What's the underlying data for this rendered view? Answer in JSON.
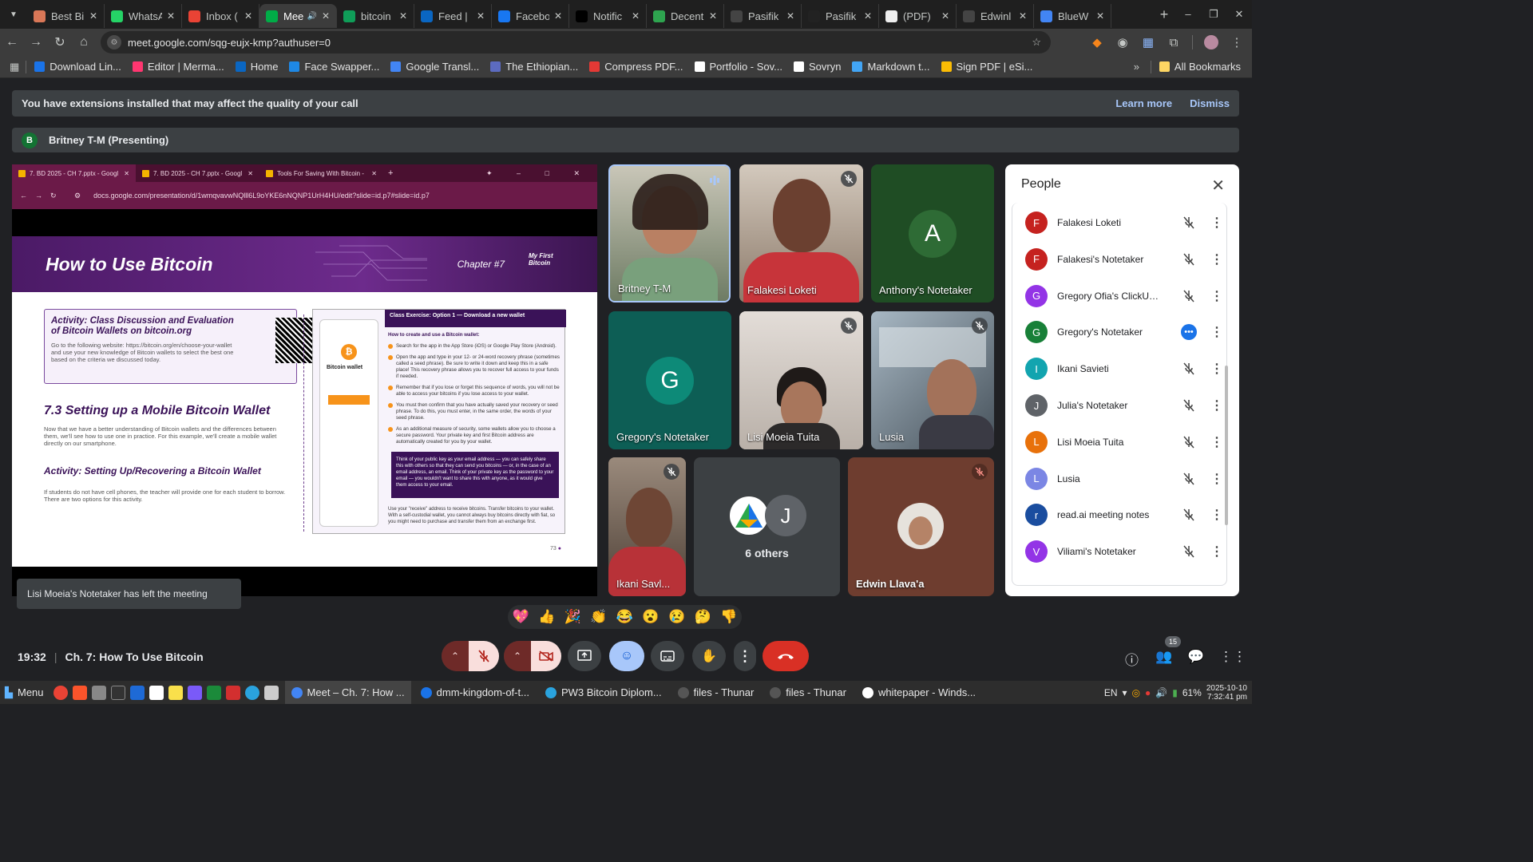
{
  "browser": {
    "tabs": [
      {
        "title": "Best Bi",
        "color": "#d97757",
        "icon": "claude-icon"
      },
      {
        "title": "WhatsA",
        "color": "#25d366",
        "icon": "whatsapp-icon"
      },
      {
        "title": "Inbox (",
        "color": "#ea4335",
        "icon": "gmail-icon"
      },
      {
        "title": "Mee",
        "color": "#00ac47",
        "icon": "meet-icon",
        "active": true
      },
      {
        "title": "bitcoin",
        "color": "#0f9d58",
        "icon": "sheets-icon"
      },
      {
        "title": "Feed |",
        "color": "#0a66c2",
        "icon": "linkedin-icon"
      },
      {
        "title": "Facebo",
        "color": "#1877f2",
        "icon": "facebook-icon"
      },
      {
        "title": "Notific",
        "color": "#000000",
        "icon": "x-icon"
      },
      {
        "title": "Decent",
        "color": "#2ea44f",
        "icon": "upwork-icon"
      },
      {
        "title": "Pasifik",
        "color": "#444444",
        "icon": "github-icon"
      },
      {
        "title": "Pasifik",
        "color": "#222222",
        "icon": "doc-icon"
      },
      {
        "title": "(PDF)",
        "color": "#eeeeee",
        "icon": "researchgate-icon"
      },
      {
        "title": "Edwinl",
        "color": "#444444",
        "icon": "github-icon"
      },
      {
        "title": "BlueW",
        "color": "#4285f4",
        "icon": "site-icon"
      }
    ],
    "url": "meet.google.com/sqg-eujx-kmp?authuser=0",
    "bookmarks": [
      {
        "label": "Download Lin...",
        "color": "#1a73e8"
      },
      {
        "label": "Editor | Merma...",
        "color": "#ff3670"
      },
      {
        "label": "Home",
        "color": "#0a66c2"
      },
      {
        "label": "Face Swapper...",
        "color": "#1e88e5"
      },
      {
        "label": "Google Transl...",
        "color": "#4285f4"
      },
      {
        "label": "The Ethiopian...",
        "color": "#5c6bc0"
      },
      {
        "label": "Compress PDF...",
        "color": "#e53935"
      },
      {
        "label": "Portfolio - Sov...",
        "color": "#ffffff"
      },
      {
        "label": "Sovryn",
        "color": "#ffffff"
      },
      {
        "label": "Markdown t...",
        "color": "#42a5f5"
      },
      {
        "label": "Sign PDF | eSi...",
        "color": "#fbbc04"
      }
    ],
    "all_bookmarks": "All Bookmarks"
  },
  "meet": {
    "banner": {
      "text": "You have extensions installed that may affect the quality of your call",
      "learn_more": "Learn more",
      "dismiss": "Dismiss"
    },
    "presenting": {
      "initial": "B",
      "text": "Britney T-M (Presenting)"
    },
    "shared_screen": {
      "tabs": [
        "7. BD 2025 - CH 7.pptx - Googl",
        "7. BD 2025 - CH 7.pptx - Googl",
        "Tools For Saving With Bitcoin -"
      ],
      "url": "docs.google.com/presentation/d/1wmqvavwNQlll6L9oYKE6nNQNP1UrH4HU/edit?slide=id.p7#slide=id.p7",
      "slide": {
        "title": "How to Use Bitcoin",
        "chapter": "Chapter #7",
        "logo": "My First Bitcoin",
        "activity_title": "Activity: Class Discussion and Evaluation of Bitcoin Wallets on bitcoin.org",
        "activity_text": "Go to the following website: https://bitcoin.org/en/choose-your-wallet and use your new knowledge of Bitcoin wallets to select the best one based on the criteria we discussed today.",
        "section_title": "7.3 Setting up a Mobile Bitcoin Wallet",
        "section_text": "Now that we have a better understanding of Bitcoin wallets and the differences between them, we'll see how to use one in practice. For this example, we'll create a mobile wallet directly on our smartphone.",
        "activity2_title": "Activity: Setting Up/Recovering a Bitcoin Wallet",
        "activity2_text": "If students do not have cell phones, the teacher will provide one for each student to borrow. There are two options for this activity.",
        "exercise_title": "Class Exercise: Option 1 — Download a new wallet",
        "exercise_sub": "How to create and use a Bitcoin wallet:",
        "phone_title": "Bitcoin wallet",
        "steps": [
          "Search for the app in the App Store (iOS) or Google Play Store (Android).",
          "Open the app and type in your 12- or 24-word recovery phrase (sometimes called a seed phrase). Be sure to write it down and keep this in a safe place! This recovery phrase allows you to recover full access to your funds if needed.",
          "Remember that if you lose or forget this sequence of words, you will not be able to access your bitcoins if you lose access to your wallet.",
          "You must then confirm that you have actually saved your recovery or seed phrase. To do this, you must enter, in the same order, the words of your seed phrase.",
          "As an additional measure of security, some wallets allow you to choose a secure password. Your private key and first Bitcoin address are automatically created for you by your wallet."
        ],
        "box_text": "Think of your public key as your email address — you can safely share this with others so that they can send you bitcoins — or, in the case of an email address, an email. Think of your private key as the password to your email — you wouldn't want to share this with anyone, as it would give them access to your email.",
        "last_step": "Use your \"receive\" address to receive bitcoins. Transfer bitcoins to your wallet. With a self-custodial wallet, you cannot always buy bitcoins directly with fiat, so you might need to purchase and transfer them from an exchange first.",
        "page": "73"
      }
    },
    "tiles": [
      {
        "name": "Britney T-M",
        "type": "video",
        "speaking": true
      },
      {
        "name": "Falakesi Loketi",
        "type": "video",
        "muted": true
      },
      {
        "name": "Anthony's Notetaker",
        "type": "avatar",
        "initial": "A",
        "color": "#1e5e2a"
      },
      {
        "name": "Gregory's Notetaker",
        "type": "avatar",
        "initial": "G",
        "color": "#0d8a78"
      },
      {
        "name": "Lisi Moeia Tuita",
        "type": "video",
        "muted": true
      },
      {
        "name": "Lusia",
        "type": "video",
        "muted": true
      },
      {
        "name": "Ikani Savl...",
        "type": "video",
        "muted": true
      },
      {
        "name": "6 others",
        "type": "others",
        "initial": "J"
      },
      {
        "name": "Edwin Llava'a",
        "type": "photo",
        "muted": true
      }
    ],
    "people_panel": {
      "title": "People",
      "participants": [
        {
          "initial": "F",
          "name": "Falakesi Loketi",
          "color": "#c5221f"
        },
        {
          "initial": "F",
          "name": "Falakesi's Notetaker",
          "color": "#c5221f"
        },
        {
          "initial": "G",
          "name": "Gregory Ofia's ClickUp ...",
          "color": "#9334e6"
        },
        {
          "initial": "G",
          "name": "Gregory's Notetaker",
          "color": "#188038",
          "active_more": true
        },
        {
          "initial": "I",
          "name": "Ikani Savieti",
          "color": "#12a4af"
        },
        {
          "initial": "J",
          "name": "Julia's Notetaker",
          "color": "#5f6368"
        },
        {
          "initial": "L",
          "name": "Lisi Moeia Tuita",
          "color": "#e8710a",
          "photo": true
        },
        {
          "initial": "L",
          "name": "Lusia",
          "color": "#7b86e4"
        },
        {
          "initial": "r",
          "name": "read.ai meeting notes",
          "color": "#1a4d9f"
        },
        {
          "initial": "V",
          "name": "Viliami's Notetaker",
          "color": "#9334e6"
        }
      ]
    },
    "toast": "Lisi Moeia's Notetaker has left the meeting",
    "reactions": [
      "💖",
      "👍",
      "🎉",
      "👏",
      "😂",
      "😮",
      "😢",
      "🤔",
      "👎"
    ],
    "time": "19:32",
    "meeting_title": "Ch. 7: How To Use Bitcoin",
    "people_count": "15"
  },
  "taskbar": {
    "menu": "Menu",
    "tasks": [
      {
        "label": "Meet – Ch. 7: How ...",
        "color": "#4285f4",
        "active": true
      },
      {
        "label": "dmm-kingdom-of-t...",
        "color": "#1a73e8"
      },
      {
        "label": "PW3 Bitcoin Diplom...",
        "color": "#2aa3de"
      },
      {
        "label": "files - Thunar",
        "color": "#555555"
      },
      {
        "label": "files - Thunar",
        "color": "#555555"
      },
      {
        "label": "whitepaper - Winds...",
        "color": "#ffffff"
      }
    ],
    "lang": "EN",
    "battery": "61%",
    "date": "2025-10-10",
    "clock": "7:32:41 pm"
  }
}
